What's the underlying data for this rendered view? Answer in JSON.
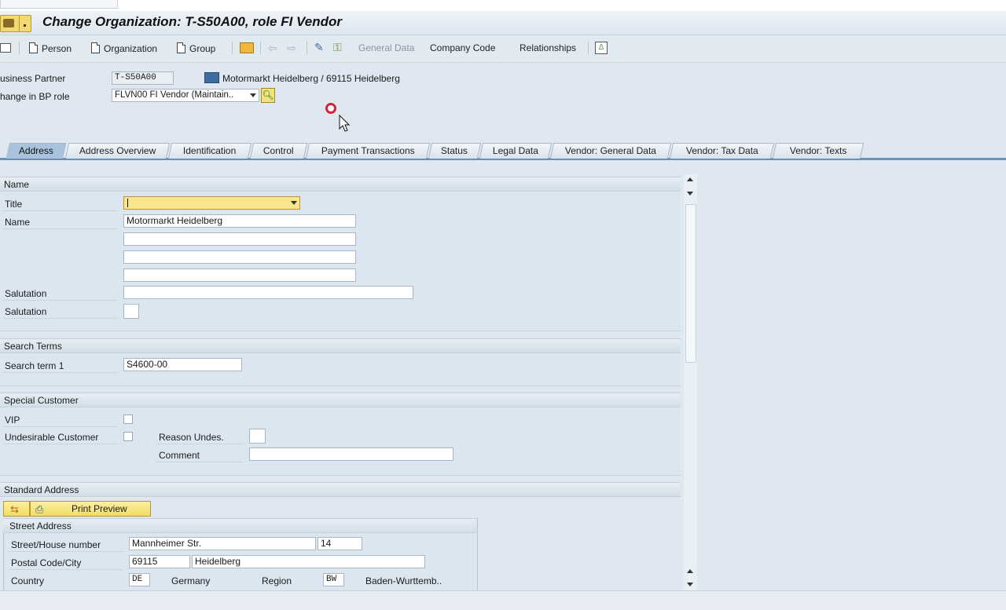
{
  "window": {
    "title": "Change Organization: T-S50A00, role FI Vendor"
  },
  "toolbar": {
    "person": "Person",
    "organization": "Organization",
    "group": "Group",
    "general_data": "General Data",
    "company_code": "Company Code",
    "relationships": "Relationships"
  },
  "header": {
    "bp_label": "usiness Partner",
    "bp_value": "T-S50A00",
    "bp_description": "Motormarkt Heidelberg / 69115 Heidelberg",
    "role_label": "hange in BP role",
    "role_value": "FLVN00 FI Vendor (Maintain.."
  },
  "tabs": [
    "Address",
    "Address Overview",
    "Identification",
    "Control",
    "Payment Transactions",
    "Status",
    "Legal Data",
    "Vendor: General Data",
    "Vendor: Tax Data",
    "Vendor: Texts"
  ],
  "active_tab": "Address",
  "name_section": {
    "header": "Name",
    "title_label": "Title",
    "title_value": "",
    "name_label": "Name",
    "name_values": [
      "Motormarkt Heidelberg",
      "",
      "",
      ""
    ],
    "salutation_label": "Salutation",
    "salutation_value": "",
    "salutation2_label": "Salutation",
    "salutation2_value": ""
  },
  "search_terms": {
    "header": "Search Terms",
    "term1_label": "Search term 1",
    "term1_value": "S4600-00"
  },
  "special_customer": {
    "header": "Special Customer",
    "vip_label": "VIP",
    "undesirable_label": "Undesirable Customer",
    "reason_label": "Reason Undes.",
    "reason_value": "",
    "comment_label": "Comment",
    "comment_value": ""
  },
  "standard_address": {
    "header": "Standard Address",
    "print_preview": "Print Preview",
    "street_header": "Street Address",
    "street_label": "Street/House number",
    "street_value": "Mannheimer Str.",
    "house_value": "14",
    "postal_label": "Postal Code/City",
    "postal_value": "69115",
    "city_value": "Heidelberg",
    "country_label": "Country",
    "country_code": "DE",
    "country_name": "Germany",
    "region_label": "Region",
    "region_code": "BW",
    "region_name": "Baden-Wurttemb.."
  },
  "colors": {
    "accent_yellow": "#f3e27c",
    "tab_active": "#a9c3dc",
    "recording_dot": "#d0243a"
  }
}
